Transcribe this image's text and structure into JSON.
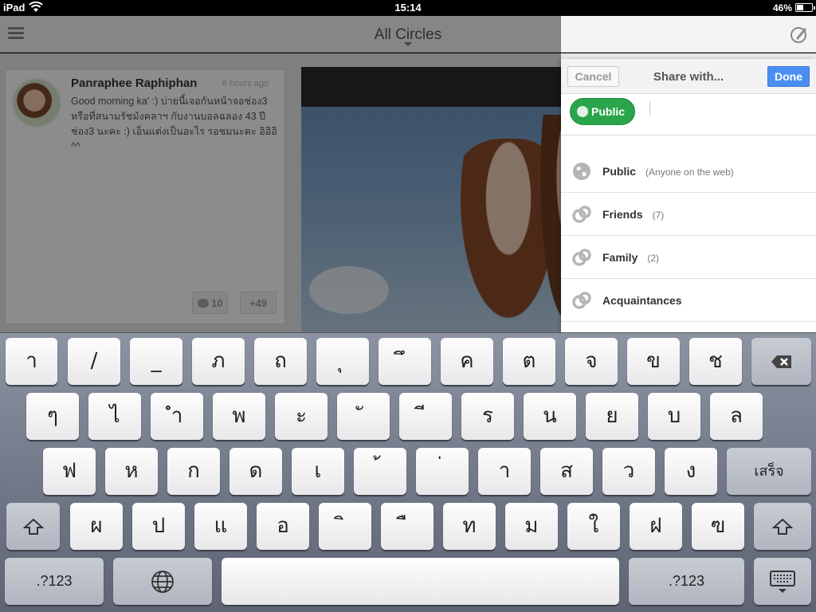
{
  "status_bar": {
    "device": "iPad",
    "time": "15:14",
    "battery": "46%",
    "battery_level": 0.46
  },
  "header": {
    "title": "All Circles"
  },
  "post": {
    "author": "Panraphee Raphiphan",
    "time_ago": "6 hours ago",
    "text": "Good morning ka' :) บ่ายนี้เจอกันหน้าจอช่อง3 หรือที่สนามรัชมังคลาฯ กับงานบอลฉลอง 43 ปีช่อง3 นะคะ :) เอ็นแต่งเป็นอะไร รอชมนะคะ อิอิอิ ^^",
    "comments": "10",
    "plus_ones": "+49"
  },
  "share": {
    "cancel_label": "Cancel",
    "title": "Share with...",
    "done_label": "Done",
    "chip_label": "Public",
    "options": [
      {
        "label": "Public",
        "detail": "(Anyone on the web)",
        "icon": "globe-icon"
      },
      {
        "label": "Friends",
        "detail": "(7)",
        "icon": "circles-icon"
      },
      {
        "label": "Family",
        "detail": "(2)",
        "icon": "circles-icon"
      },
      {
        "label": "Acquaintances",
        "detail": "",
        "icon": "circles-icon"
      }
    ]
  },
  "keyboard": {
    "row1": [
      "า",
      "/",
      "_",
      "ภ",
      "ถ",
      "ุ",
      "ึ",
      "ค",
      "ต",
      "จ",
      "ข",
      "ช"
    ],
    "row2": [
      "ๆ",
      "ไ",
      "ำ",
      "พ",
      "ะ",
      "ั",
      "ี",
      "ร",
      "น",
      "ย",
      "บ",
      "ล"
    ],
    "row3": [
      "ฟ",
      "ห",
      "ก",
      "ด",
      "เ",
      "้",
      "่",
      "า",
      "ส",
      "ว",
      "ง"
    ],
    "return_label": "เสร็จ",
    "row4": [
      "ผ",
      "ป",
      "แ",
      "อ",
      "ิ",
      "ื",
      "ท",
      "ม",
      "ใ",
      "ฝ",
      "ฃ"
    ],
    "numbers_label": ".?123",
    "icons": [
      "backspace-icon",
      "shift-icon",
      "globe-icon",
      "keyboard-dismiss-icon"
    ]
  }
}
